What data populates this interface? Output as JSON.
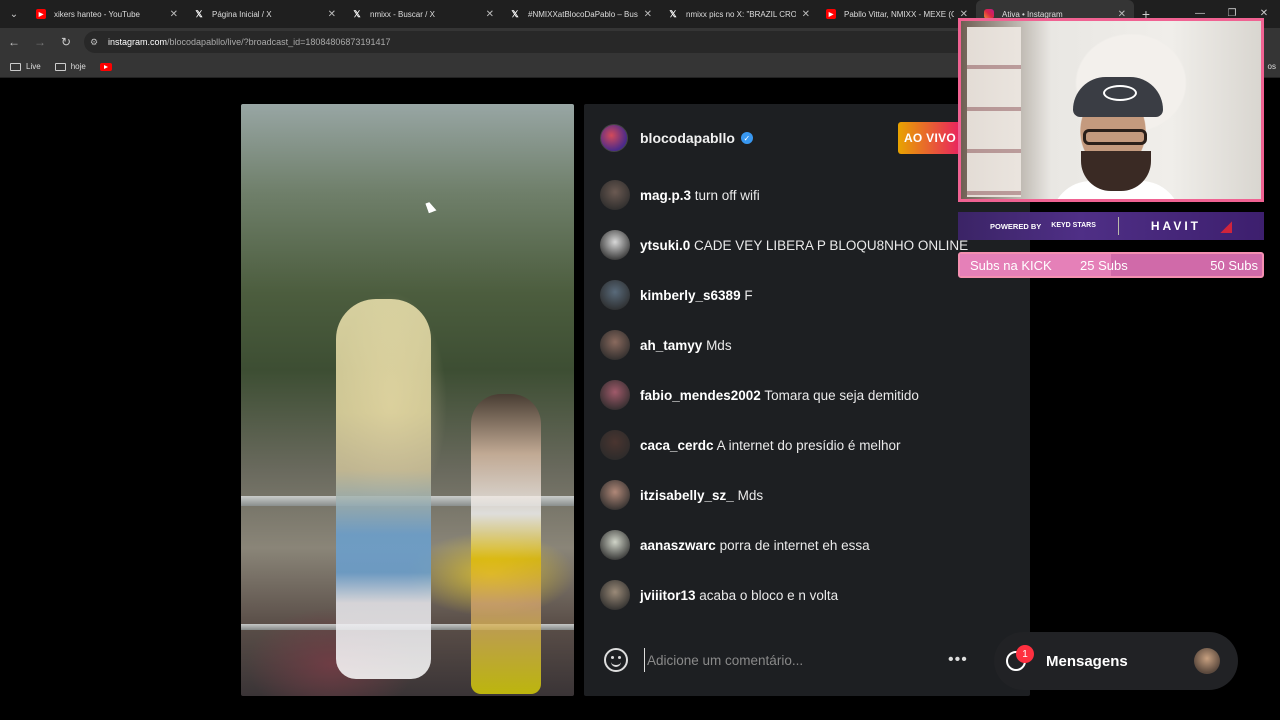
{
  "browser": {
    "tabs": [
      {
        "icon": "youtube-icon",
        "label": "xikers hanteo - YouTube",
        "active": false
      },
      {
        "icon": "x-icon",
        "label": "Página Inicial / X",
        "active": false
      },
      {
        "icon": "x-icon",
        "label": "nmixx - Buscar / X",
        "active": false
      },
      {
        "icon": "x-icon",
        "label": "#NMIXXatBlocoDaPablo – Busc",
        "active": false
      },
      {
        "icon": "x-icon",
        "label": "nmixx pics no X: \"BRAZIL CROW",
        "active": false
      },
      {
        "icon": "youtube-icon",
        "label": "Pabllo Vittar, NMIXX - MEXE (O",
        "active": false
      },
      {
        "icon": "instagram-icon",
        "label": "Ativa • Instagram",
        "active": true
      }
    ],
    "address": {
      "host": "instagram.com",
      "path": "/blocodapabllo/live/?broadcast_id=18084806873191417"
    },
    "bookmarks": [
      {
        "icon": "folder-icon",
        "label": "Live"
      },
      {
        "icon": "folder-icon",
        "label": "hoje"
      },
      {
        "icon": "youtube-icon",
        "label": ""
      }
    ],
    "bookmarks_more": "os"
  },
  "live": {
    "host_username": "blocodapabllo",
    "live_badge": "AO VIVO",
    "comments": [
      {
        "user": "mag.p.3",
        "text": "turn off wifi",
        "avatar_color": "#6b5a52"
      },
      {
        "user": "ytsuki.0",
        "text": "CADE VEY LIBERA P BLOQU8NHO ONLINE",
        "avatar_color": "#d8d8d8"
      },
      {
        "user": "kimberly_s6389",
        "text": "F",
        "avatar_color": "#596a7a"
      },
      {
        "user": "ah_tamyy",
        "text": "Mds",
        "avatar_color": "#8a6a5e"
      },
      {
        "user": "fabio_mendes2002",
        "text": "Tomara que seja demitido",
        "avatar_color": "#a05a6a"
      },
      {
        "user": "caca_cerdc",
        "text": "A internet do presídio é melhor",
        "avatar_color": "#4a3530"
      },
      {
        "user": "itzisabelly_sz_",
        "text": "Mds",
        "avatar_color": "#b08878"
      },
      {
        "user": "aanaszwarc",
        "text": "porra de internet eh essa",
        "avatar_color": "#d0d4c8"
      },
      {
        "user": "jviiitor13",
        "text": "acaba o bloco e n volta",
        "avatar_color": "#9a8a78"
      }
    ],
    "comment_placeholder": "Adicione um comentário...",
    "more_label": "•••"
  },
  "messages": {
    "label": "Mensagens",
    "unread_count": "1"
  },
  "overlay": {
    "sponsor_powered_by": "POWERED BY",
    "sponsor_brand_1": "KEYD STARS",
    "sponsor_brand_2": "HAVIT",
    "subs_title": "Subs na KICK",
    "subs_current": "25 Subs",
    "subs_goal": "50 Subs",
    "subs_progress": 0.5
  }
}
